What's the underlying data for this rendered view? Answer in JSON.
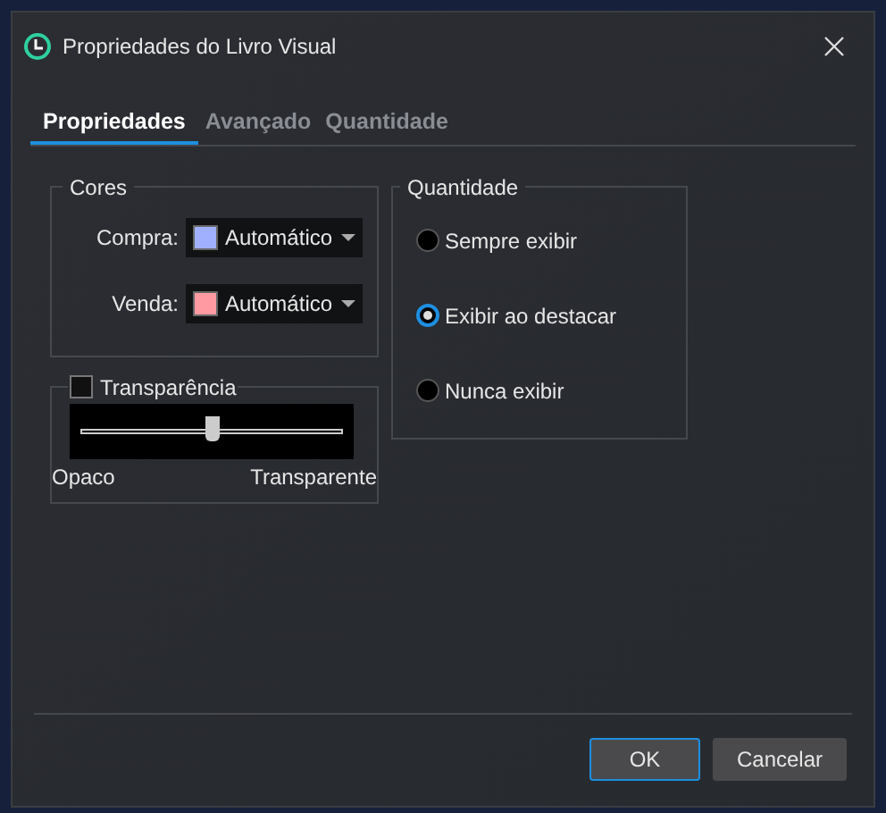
{
  "window": {
    "title": "Propriedades do Livro Visual"
  },
  "tabs": [
    {
      "label": "Propriedades",
      "selected": true
    },
    {
      "label": "Avançado",
      "selected": false
    },
    {
      "label": "Quantidade",
      "selected": false
    }
  ],
  "colors": {
    "title": "Cores",
    "rows": [
      {
        "label": "Compra:",
        "value": "Automático",
        "color": "#a0b0ff"
      },
      {
        "label": "Venda:",
        "value": "Automático",
        "color": "#ff9aa2"
      }
    ]
  },
  "transparency": {
    "label": "Transparência",
    "checked": false,
    "level": 0.5,
    "min_label": "Opaco",
    "max_label": "Transparente"
  },
  "quantity": {
    "title": "Quantidade",
    "options": [
      {
        "label": "Sempre exibir",
        "selected": false
      },
      {
        "label": "Exibir ao destacar",
        "selected": true
      },
      {
        "label": "Nunca exibir",
        "selected": false
      }
    ]
  },
  "buttons": [
    {
      "label": "OK",
      "kind": "primary"
    },
    {
      "label": "Cancelar",
      "kind": "secondary"
    }
  ]
}
